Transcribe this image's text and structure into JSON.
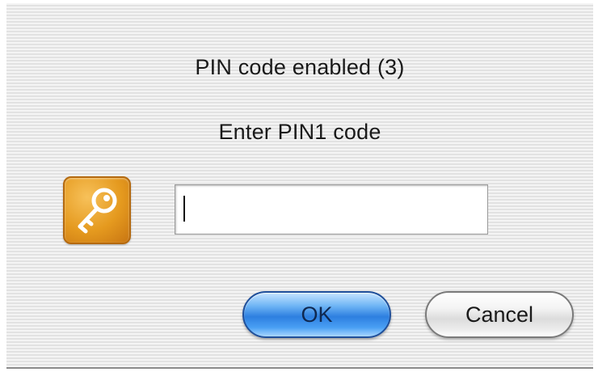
{
  "dialog": {
    "title": "PIN code enabled (3)",
    "prompt": "Enter PIN1 code",
    "icon": "key-icon",
    "pin_input": {
      "value": "",
      "placeholder": ""
    },
    "ok_label": "OK",
    "cancel_label": "Cancel"
  },
  "colors": {
    "ok_button": "#2d7fe0",
    "icon_background": "#e59a1f"
  }
}
